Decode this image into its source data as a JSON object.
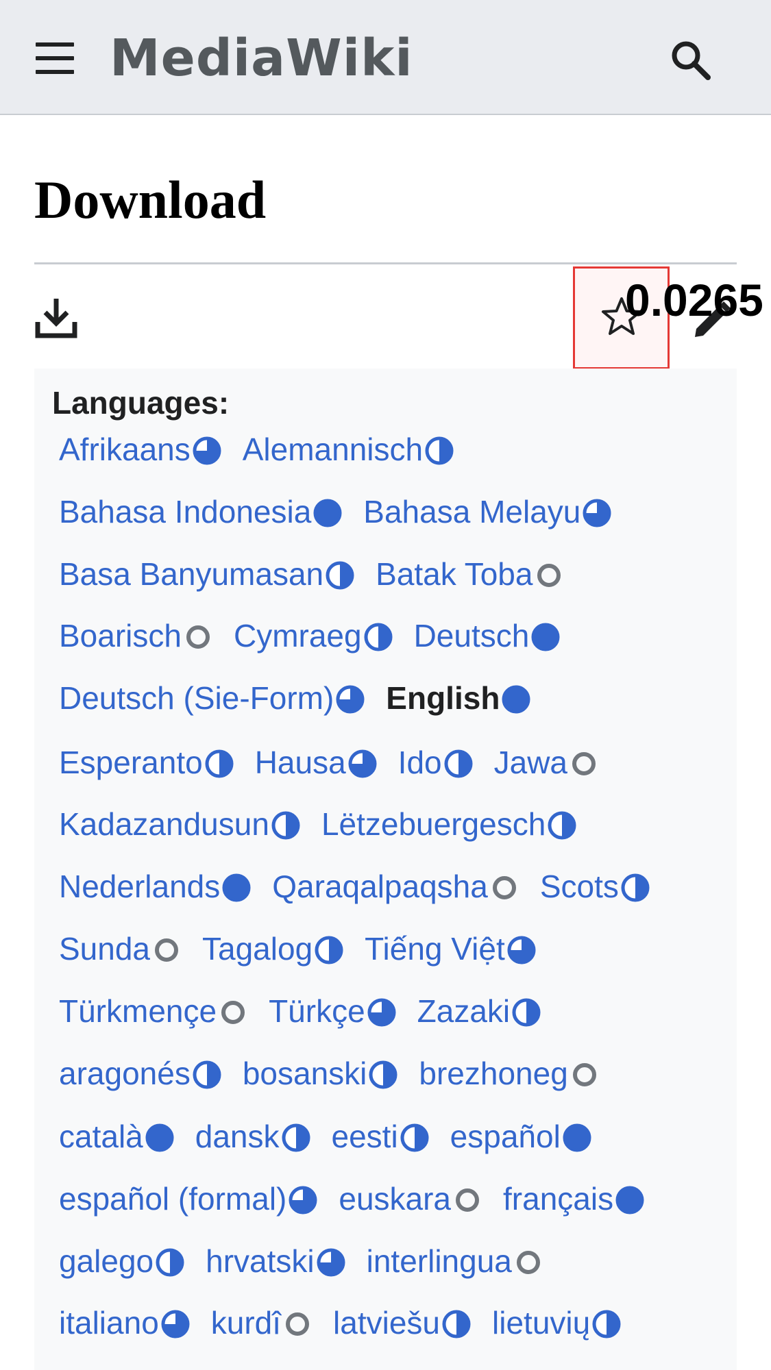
{
  "header": {
    "site_title": "MediaWiki",
    "menu_icon": "hamburger-menu-icon",
    "search_icon": "search-icon"
  },
  "page": {
    "title": "Download",
    "overlay_value": "0.0265"
  },
  "toolbar": {
    "download_icon": "download-icon",
    "watch_icon": "star-outline-icon",
    "edit_icon": "pencil-edit-icon"
  },
  "languages": {
    "heading": "Languages:",
    "rows": [
      [
        {
          "name": "Afrikaans",
          "status": "three-quarter"
        },
        {
          "name": "Alemannisch",
          "status": "half"
        }
      ],
      [
        {
          "name": "Bahasa Indonesia",
          "status": "full"
        },
        {
          "name": "Bahasa Melayu",
          "status": "three-quarter"
        }
      ],
      [
        {
          "name": "Basa Banyumasan",
          "status": "half"
        },
        {
          "name": "Batak Toba",
          "status": "empty"
        }
      ],
      [
        {
          "name": "Boarisch",
          "status": "empty"
        },
        {
          "name": "Cymraeg",
          "status": "half"
        },
        {
          "name": "Deutsch",
          "status": "full"
        }
      ],
      [
        {
          "name": "Deutsch (Sie-Form)",
          "status": "three-quarter"
        },
        {
          "name": "English",
          "status": "full",
          "current": true
        }
      ],
      [
        {
          "name": "Esperanto",
          "status": "half"
        },
        {
          "name": "Hausa",
          "status": "three-quarter"
        },
        {
          "name": "Ido",
          "status": "half"
        },
        {
          "name": "Jawa",
          "status": "empty"
        }
      ],
      [
        {
          "name": "Kadazandusun",
          "status": "half"
        },
        {
          "name": "Lëtzebuergesch",
          "status": "half"
        }
      ],
      [
        {
          "name": "Nederlands",
          "status": "full"
        },
        {
          "name": "Qaraqalpaqsha",
          "status": "empty"
        },
        {
          "name": "Scots",
          "status": "half"
        }
      ],
      [
        {
          "name": "Sunda",
          "status": "empty"
        },
        {
          "name": "Tagalog",
          "status": "half"
        },
        {
          "name": "Tiếng Việt",
          "status": "three-quarter"
        }
      ],
      [
        {
          "name": "Türkmençe",
          "status": "empty"
        },
        {
          "name": "Türkçe",
          "status": "three-quarter"
        },
        {
          "name": "Zazaki",
          "status": "half"
        }
      ],
      [
        {
          "name": "aragonés",
          "status": "half"
        },
        {
          "name": "bosanski",
          "status": "half"
        },
        {
          "name": "brezhoneg",
          "status": "empty"
        }
      ],
      [
        {
          "name": "català",
          "status": "full"
        },
        {
          "name": "dansk",
          "status": "half"
        },
        {
          "name": "eesti",
          "status": "half"
        },
        {
          "name": "español",
          "status": "full"
        }
      ],
      [
        {
          "name": "español (formal)",
          "status": "three-quarter"
        },
        {
          "name": "euskara",
          "status": "empty"
        },
        {
          "name": "français",
          "status": "full"
        }
      ],
      [
        {
          "name": "galego",
          "status": "half"
        },
        {
          "name": "hrvatski",
          "status": "three-quarter"
        },
        {
          "name": "interlingua",
          "status": "empty"
        }
      ],
      [
        {
          "name": "italiano",
          "status": "three-quarter"
        },
        {
          "name": "kurdî",
          "status": "empty"
        },
        {
          "name": "latviešu",
          "status": "half"
        },
        {
          "name": "lietuvių",
          "status": "half"
        }
      ]
    ]
  },
  "colors": {
    "link": "#3366cc",
    "badge": "#3366cc",
    "badge_empty": "#72777d",
    "highlight": "#e53935"
  }
}
